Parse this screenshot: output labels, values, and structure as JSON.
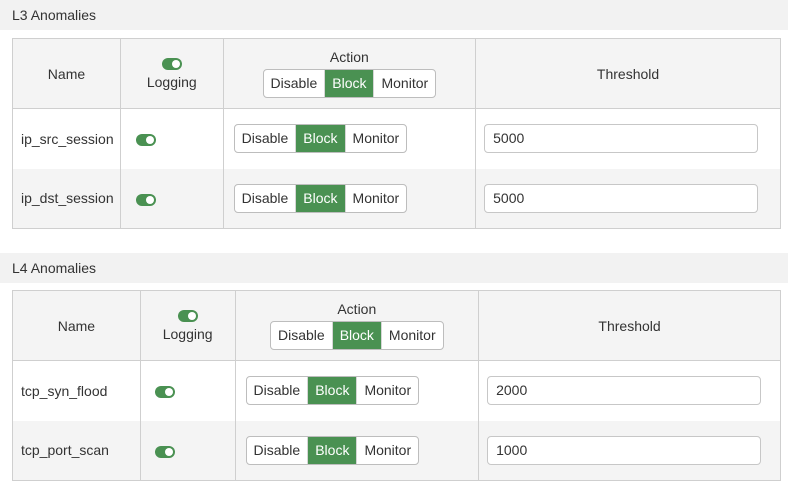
{
  "sections": [
    {
      "title": "L3 Anomalies",
      "headers": {
        "name": "Name",
        "logging": "Logging",
        "action": "Action",
        "threshold": "Threshold"
      },
      "action_options": [
        "Disable",
        "Block",
        "Monitor"
      ],
      "selected_action": "Block",
      "rows": [
        {
          "name": "ip_src_session",
          "logging": true,
          "action": "Block",
          "threshold": "5000"
        },
        {
          "name": "ip_dst_session",
          "logging": true,
          "action": "Block",
          "threshold": "5000"
        }
      ]
    },
    {
      "title": "L4 Anomalies",
      "headers": {
        "name": "Name",
        "logging": "Logging",
        "action": "Action",
        "threshold": "Threshold"
      },
      "action_options": [
        "Disable",
        "Block",
        "Monitor"
      ],
      "selected_action": "Block",
      "rows": [
        {
          "name": "tcp_syn_flood",
          "logging": true,
          "action": "Block",
          "threshold": "2000"
        },
        {
          "name": "tcp_port_scan",
          "logging": true,
          "action": "Block",
          "threshold": "1000"
        }
      ]
    }
  ],
  "colors": {
    "accent": "#4a9152",
    "header_bg": "#f2f2f2",
    "border": "#cfcfcf"
  },
  "icons": {
    "logging_toggle": "toggle-on-icon"
  }
}
